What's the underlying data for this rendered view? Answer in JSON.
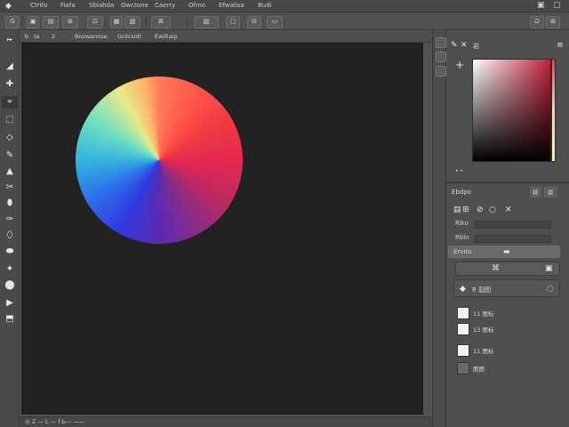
{
  "menubar": {
    "items": [
      "Ctrito",
      "Fiafa",
      "Sbiahda",
      "Owctone",
      "Caerry",
      "Ofmo",
      "Efwalisa",
      "Budi"
    ]
  },
  "optionsbar": {
    "buttons": [
      "G",
      "▣",
      "▤",
      "⊞",
      "⊡",
      "▦",
      "▧",
      "⊠",
      "▨",
      "▢",
      "⊟",
      "▭",
      "⊡",
      "⊞"
    ]
  },
  "tools": [
    "◢",
    "✚",
    "⌖",
    "⬚",
    "◇",
    "✎",
    "▲",
    "✂",
    "⬮",
    "✑",
    "⬯",
    "⬬",
    "✦",
    "⬤",
    "▶",
    "⬒"
  ],
  "doc_tab": {
    "items": [
      "b",
      "ta",
      "2",
      "Bozwanose",
      "Grdcsidt",
      "Ewiltaip"
    ]
  },
  "status": {
    "zoom_text": "◎ ℤ — Ꮮ — ꟾ Ꮟ— ——"
  },
  "color_panel": {
    "title": "岩",
    "accent": "#c1203a"
  },
  "properties_panel": {
    "title": "Ebdpo",
    "rows": [
      "Riko",
      "Rbln"
    ]
  },
  "layers_panel": {
    "header": "Ervito",
    "active_label": "R 副图",
    "layers": [
      {
        "name": "11 图标"
      },
      {
        "name": "13 图标"
      },
      {
        "name": "11 图标"
      },
      {
        "name": "图图"
      }
    ]
  }
}
